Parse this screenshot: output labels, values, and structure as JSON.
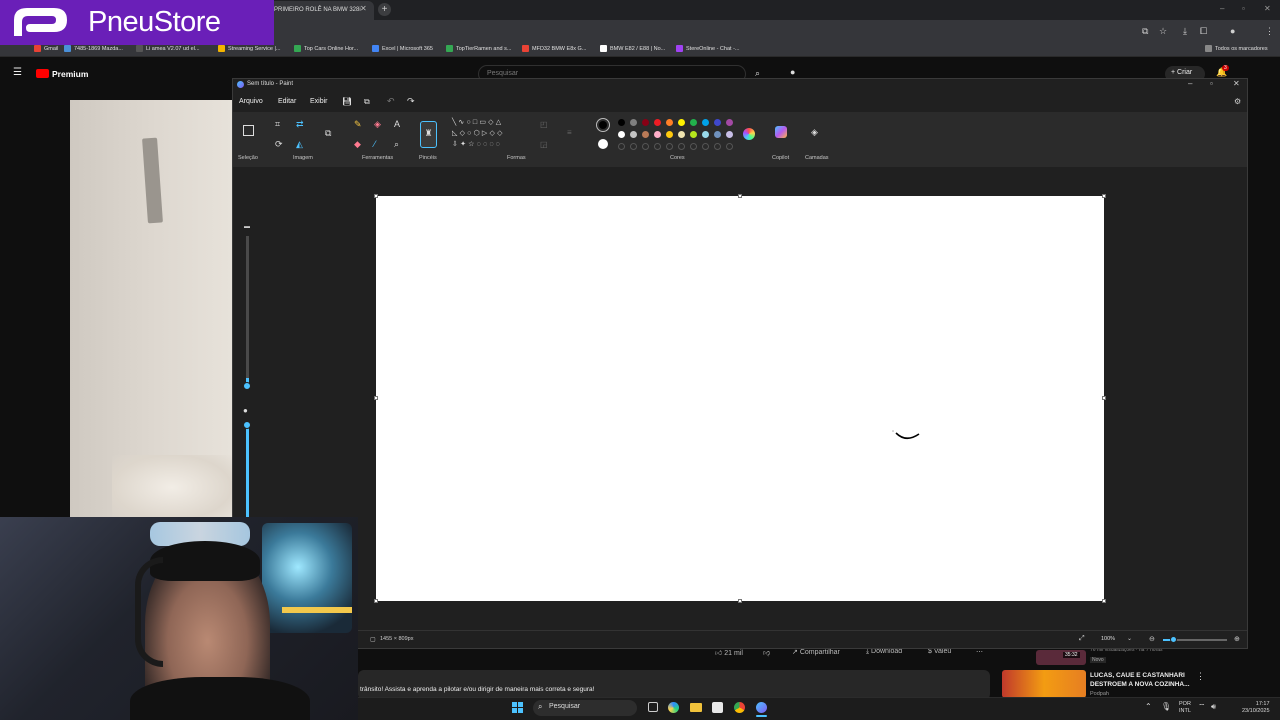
{
  "logo": {
    "text": "PneuStore"
  },
  "browser": {
    "tabs": [
      {
        "label": "PRIMEIRO ROLÊ NA BMW 328i",
        "active": true
      }
    ],
    "bookmarks": [
      {
        "label": "Gmail",
        "color": "#e94235"
      },
      {
        "label": "7485-1869 Mazda...",
        "color": "#4a90d9"
      },
      {
        "label": "Li amea V2.07 ud el...",
        "color": "#555555"
      },
      {
        "label": "Streaming Service |...",
        "color": "#f4b400"
      },
      {
        "label": "Top Cars Online Hor...",
        "color": "#34a853"
      },
      {
        "label": "Excel | Microsoft 365",
        "color": "#4285f4"
      },
      {
        "label": "TopTierRamen and s...",
        "color": "#34a853"
      },
      {
        "label": "MFD32 BMW E8x G...",
        "color": "#ea4335"
      },
      {
        "label": "BMW E82 / E88 | No...",
        "color": "#ffffff"
      },
      {
        "label": "StereOnline - Chat -...",
        "color": "#a142f4"
      }
    ],
    "bookmarks_right": "Todos os marcadores"
  },
  "youtube": {
    "logo_label": "Premium",
    "search_placeholder": "Pesquisar",
    "create_label": "Criar",
    "notification_count": "3",
    "actions": {
      "likes": "21 mil",
      "share": "Compartilhar",
      "download": "Download",
      "thanks": "Valeu"
    },
    "description": "trânsito! Assista e aprenda a pilotar e/ou dirigir de maneira mais correta e segura!",
    "recommended": {
      "title": "LUCAS, CAUE E CASTANHARI DESTROEM A NOVA COZINHA...",
      "channel": "Podpah",
      "prev_duration": "35:32",
      "prev_meta": "76 mil visualizações · há 7 horas",
      "prev_badge": "Novo"
    }
  },
  "paint": {
    "title": "Sem título - Paint",
    "menu": [
      "Arquivo",
      "Editar",
      "Exibir"
    ],
    "groups": {
      "selection": "Seleção",
      "image": "Imagem",
      "tools": "Ferramentas",
      "brushes": "Pincéis",
      "shapes": "Formas",
      "colors": "Cores",
      "copilot": "Copilot",
      "layers": "Camadas"
    },
    "palette_row1": [
      "#000000",
      "#7f7f7f",
      "#880015",
      "#ed1c24",
      "#ff7f27",
      "#fff200",
      "#22b14c",
      "#00a2e8",
      "#3f48cc",
      "#a349a4"
    ],
    "palette_row2": [
      "#ffffff",
      "#c3c3c3",
      "#b97a57",
      "#ffaec9",
      "#ffc90e",
      "#efe4b0",
      "#b5e61d",
      "#99d9ea",
      "#7092be",
      "#c8bfe7"
    ],
    "primary_color": "#000000",
    "secondary_color": "#ffffff",
    "status": {
      "canvas_size": "1455 × 809px",
      "zoom": "100%"
    },
    "zoom_level": 0.15
  },
  "taskbar": {
    "search": "Pesquisar",
    "lang": "POR",
    "lang2": "INTL",
    "time": "17:17",
    "date": "23/10/2025"
  }
}
